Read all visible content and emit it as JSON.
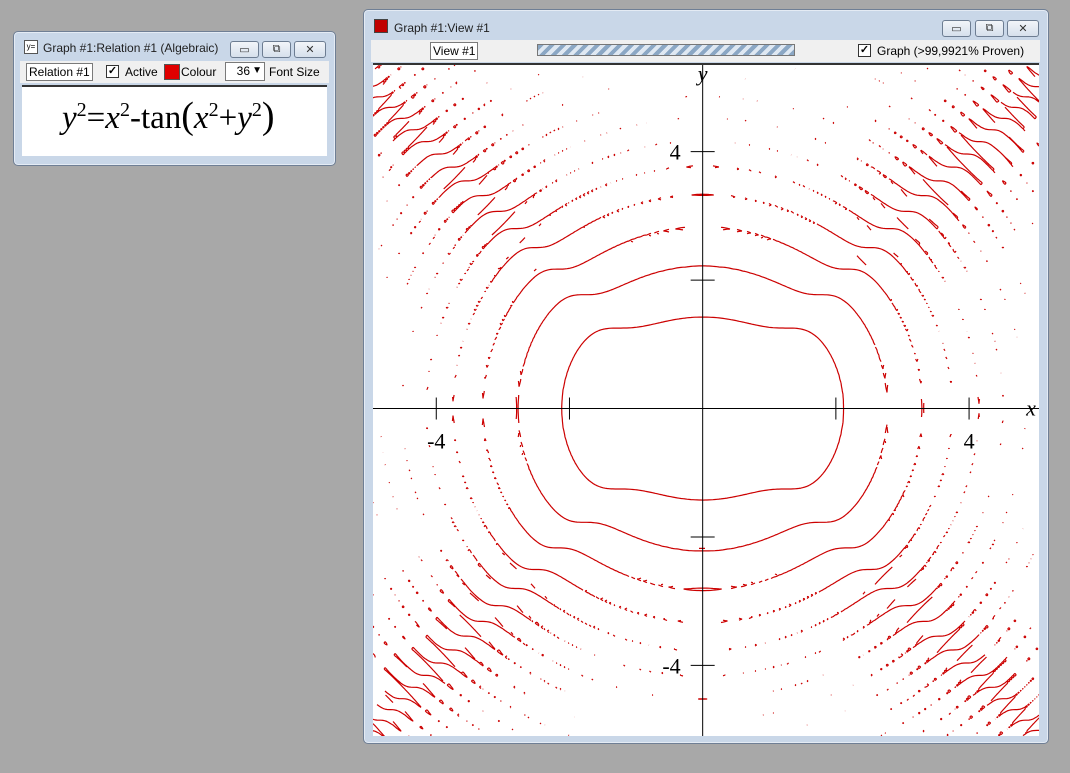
{
  "relation_window": {
    "title": "Graph #1:Relation #1 (Algebraic)",
    "icon": "equation-icon",
    "name_value": "Relation #1",
    "active_label": "Active",
    "active_checked": true,
    "colour_label": "Colour",
    "colour": "#e00000",
    "font_size_value": "36",
    "font_size_label": "Font Size",
    "equation": {
      "lhs_var": "y",
      "lhs_exp": "2",
      "eq": "=",
      "x_var": "x",
      "x_exp": "2",
      "minus": "-",
      "func": "tan",
      "open_paren": "(",
      "x2_var": "x",
      "x2_exp": "2",
      "plus": "+",
      "y2_var": "y",
      "y2_exp": "2",
      "close_paren": ")"
    }
  },
  "graph_window": {
    "title": "Graph #1:View #1",
    "icon": "graph-icon",
    "view_name_value": "View #1",
    "graph_checked": true,
    "graph_label": "Graph (>99,9921% Proven)"
  },
  "window_controls": {
    "minimize": "▭",
    "restore": "⧉",
    "close": "✕"
  },
  "chart_data": {
    "type": "line",
    "relation": "y^2 = x^2 - tan(x^2 + y^2)",
    "xlabel": "x",
    "ylabel": "y",
    "xlim": [
      -4.95,
      5.05
    ],
    "ylim": [
      -5.1,
      5.35
    ],
    "tick_labels": {
      "x_neg": "-4",
      "x_pos": "4",
      "y_pos": "4",
      "y_neg": "-4"
    },
    "line_color": "#cc0000",
    "grid": false
  }
}
